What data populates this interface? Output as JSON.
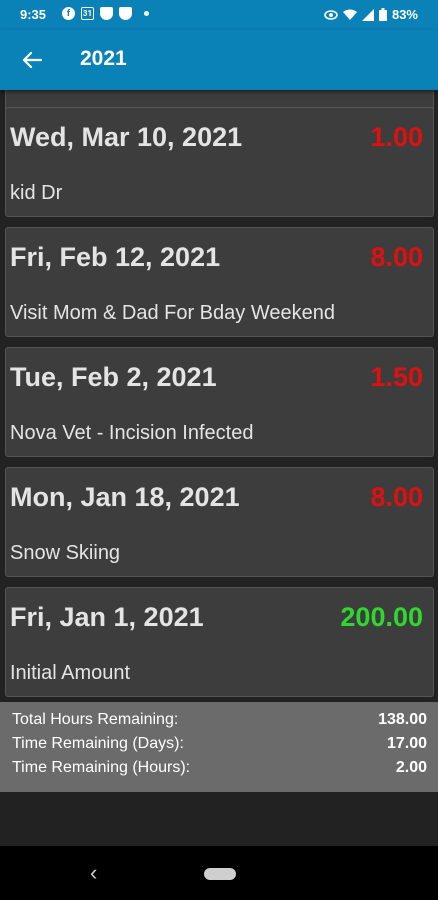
{
  "status_bar": {
    "time": "9:35",
    "battery": "83%",
    "left_icons": [
      "facebook-icon",
      "calendar-icon",
      "shield-icon",
      "shield-icon",
      "dot-icon"
    ],
    "right_icons": [
      "eye-icon",
      "wifi-icon",
      "signal-icon",
      "battery-icon"
    ]
  },
  "app_bar": {
    "title": "2021",
    "back_icon": "arrow-left-icon",
    "background": "#0b82b7"
  },
  "entries": [
    {
      "date": "Wed, Mar 10, 2021",
      "amount": "1.00",
      "note": "kid Dr",
      "color": "#e01010"
    },
    {
      "date": "Fri, Feb 12, 2021",
      "amount": "8.00",
      "note": "Visit Mom & Dad For Bday Weekend",
      "color": "#e01010"
    },
    {
      "date": "Tue, Feb 2, 2021",
      "amount": "1.50",
      "note": "Nova Vet - Incision Infected",
      "color": "#e01010"
    },
    {
      "date": "Mon, Jan 18, 2021",
      "amount": "8.00",
      "note": "Snow Skiing",
      "color": "#e01010"
    },
    {
      "date": "Fri, Jan 1, 2021",
      "amount": "200.00",
      "note": "Initial Amount",
      "color": "#2fd82f"
    }
  ],
  "summary": [
    {
      "label": "Total Hours Remaining:",
      "value": "138.00"
    },
    {
      "label": "Time Remaining (Days):",
      "value": "17.00"
    },
    {
      "label": "Time Remaining (Hours):",
      "value": "2.00"
    }
  ],
  "nav": {
    "back_glyph": "‹"
  }
}
